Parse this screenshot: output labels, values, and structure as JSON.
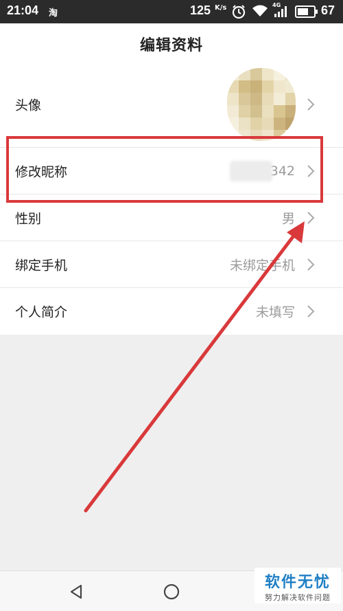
{
  "status_bar": {
    "time": "21:04",
    "notif_app": "淘",
    "net_speed": "125",
    "net_speed_unit": "K/s",
    "network_type": "4G",
    "battery_percent": "67",
    "battery_level": 0.67
  },
  "header": {
    "title": "编辑资料"
  },
  "profile_rows": [
    {
      "label": "头像",
      "value": ""
    },
    {
      "label": "修改昵称",
      "value": "342"
    },
    {
      "label": "性别",
      "value": "男"
    },
    {
      "label": "绑定手机",
      "value": "未绑定手机"
    },
    {
      "label": "个人简介",
      "value": "未填写"
    }
  ],
  "colors": {
    "highlight_box": "#d9393b",
    "annotation_arrow": "#d9393b",
    "status_bar_bg": "#2b2b2b",
    "watermark_blue": "#1f7fc4"
  },
  "icons": {
    "row_chevron": "chevron-right-icon",
    "nav_back": "back-triangle-icon",
    "nav_home": "home-circle-icon",
    "alarm": "alarm-clock-icon",
    "wifi": "wifi-icon",
    "signal": "signal-bars-icon",
    "battery": "battery-icon"
  },
  "watermark": {
    "title": "软件无忧",
    "subtitle": "努力解决软件问题"
  }
}
